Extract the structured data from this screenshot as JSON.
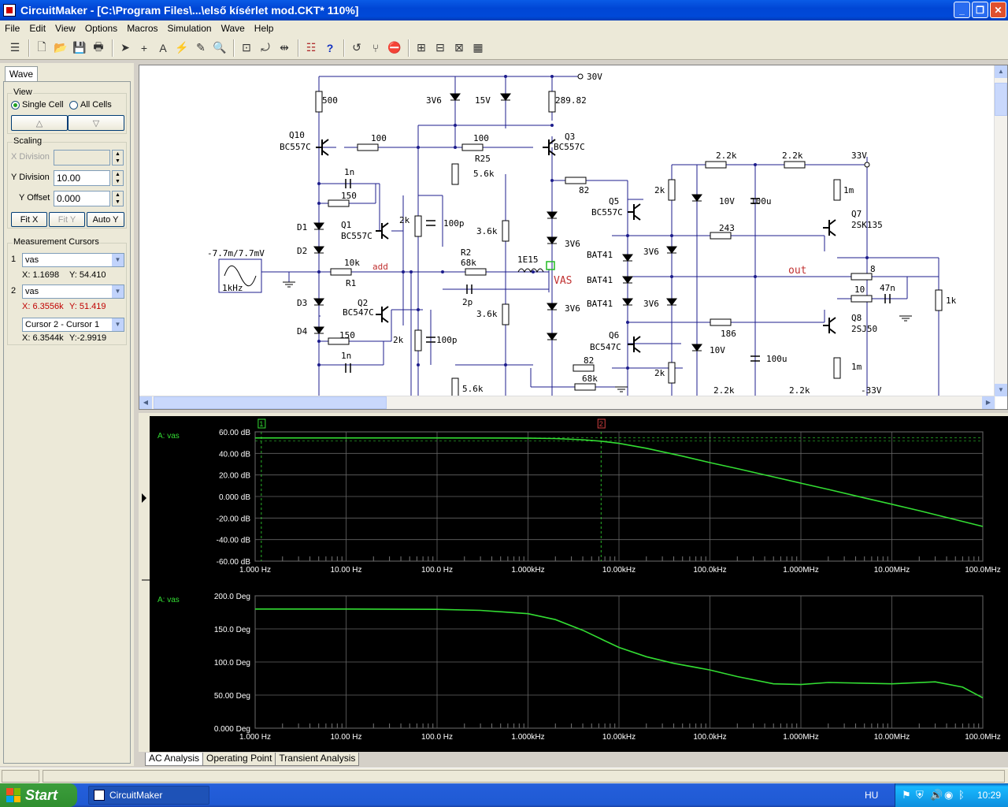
{
  "window": {
    "title": "CircuitMaker - [C:\\Program Files\\...\\első kísérlet mod.CKT* 110%]"
  },
  "menu": [
    "File",
    "Edit",
    "View",
    "Options",
    "Macros",
    "Simulation",
    "Wave",
    "Help"
  ],
  "panel": {
    "tab": "Wave",
    "view": {
      "label": "View",
      "single": "Single Cell",
      "all": "All Cells"
    },
    "scaling": {
      "label": "Scaling",
      "xdiv_label": "X Division",
      "xdiv_value": "",
      "ydiv_label": "Y Division",
      "ydiv_value": "10.00",
      "yoff_label": "Y Offset",
      "yoff_value": "0.000",
      "fitx": "Fit X",
      "fity": "Fit Y",
      "autoy": "Auto Y"
    },
    "cursors": {
      "label": "Measurement Cursors",
      "c1": {
        "num": "1",
        "signal": "vas",
        "x": "X: 1.1698",
        "y": "Y: 54.410"
      },
      "c2": {
        "num": "2",
        "signal": "vas",
        "x": "X: 6.3556k",
        "y": "Y: 51.419"
      },
      "diff": {
        "signal": "Cursor 2 - Cursor 1",
        "x": "X: 6.3544k",
        "y": "Y:-2.9919"
      }
    }
  },
  "schematic": {
    "labels": [
      "30V",
      "3V6",
      "15V",
      "500",
      "289.82",
      "Q10",
      "BC557C",
      "100",
      "100",
      "Q3",
      "BC557C",
      "R25",
      "5.6k",
      "2.2k",
      "2.2k",
      "33V",
      "82",
      "2k",
      "10V",
      "100u",
      "1m",
      "Q5",
      "BC557C",
      "1n",
      "3V6",
      "Q7",
      "2SK135",
      "150",
      "2k",
      "100p",
      "3.6k",
      "D1",
      "Q1",
      "BC557C",
      "243",
      "D2",
      "-7.7m/7.7mV",
      "10k",
      "add",
      "R2",
      "68k",
      "1E15",
      "BAT41",
      "3V6",
      "VAS",
      "out",
      "8",
      "R1",
      "BAT41",
      "10",
      "47n",
      "1k",
      "1kHz",
      "2p",
      "BAT41",
      "3V6",
      "D3",
      "Q2",
      "BC547C",
      "3V6",
      "3.6k",
      "Q8",
      "2SJ50",
      "186",
      "D4",
      "150",
      "2k",
      "100p",
      "Q6",
      "BC547C",
      "1n",
      "82",
      "10V",
      "100u",
      "1m",
      "68k",
      "2k",
      "5.6k",
      "2.2k",
      "2.2k",
      "-33V"
    ]
  },
  "chart_data": [
    {
      "type": "line",
      "title": "A: vas",
      "xlabel": "",
      "ylabel": "",
      "xscale": "log",
      "xlim": [
        1,
        100000000
      ],
      "ylim": [
        -60,
        60
      ],
      "xticks": [
        "1.000 Hz",
        "10.00 Hz",
        "100.0 Hz",
        "1.000kHz",
        "10.00kHz",
        "100.0kHz",
        "1.000MHz",
        "10.00MHz",
        "100.0MHz"
      ],
      "yticks": [
        "60.00 dB",
        "40.00 dB",
        "20.00 dB",
        "0.000 dB",
        "-20.00 dB",
        "-40.00 dB",
        "-60.00 dB"
      ],
      "series": [
        {
          "name": "vas",
          "color": "#33dd33",
          "x": [
            1,
            10,
            100,
            1000,
            2000,
            4000,
            6356,
            10000,
            20000,
            50000,
            100000,
            200000,
            500000,
            1000000,
            2000000,
            5000000,
            10000000,
            20000000,
            50000000,
            100000000
          ],
          "y": [
            54.4,
            54.4,
            54.4,
            54.2,
            53.8,
            52.7,
            51.4,
            49.3,
            44.8,
            37.5,
            31.5,
            25.9,
            18.2,
            12.4,
            6.6,
            -1.3,
            -7.2,
            -13.2,
            -21.5,
            -27.8
          ]
        }
      ],
      "cursors": [
        {
          "label": "1",
          "x": 1.1698
        },
        {
          "label": "2",
          "x": 6355.6
        }
      ],
      "grid": true
    },
    {
      "type": "line",
      "title": "A: vas",
      "xlabel": "",
      "ylabel": "",
      "xscale": "log",
      "xlim": [
        1,
        100000000
      ],
      "ylim": [
        0,
        200
      ],
      "xticks": [
        "1.000 Hz",
        "10.00 Hz",
        "100.0 Hz",
        "1.000kHz",
        "10.00kHz",
        "100.0kHz",
        "1.000MHz",
        "10.00MHz",
        "100.0MHz"
      ],
      "yticks": [
        "200.0 Deg",
        "150.0 Deg",
        "100.0 Deg",
        "50.00 Deg",
        "0.000 Deg"
      ],
      "series": [
        {
          "name": "vas",
          "color": "#33dd33",
          "x": [
            1,
            10,
            100,
            300,
            1000,
            2000,
            4000,
            7000,
            10000,
            20000,
            40000,
            100000,
            200000,
            500000,
            1000000,
            2000000,
            5000000,
            10000000,
            30000000,
            60000000,
            100000000
          ],
          "y": [
            180,
            180,
            179.5,
            178,
            173,
            164,
            148,
            132,
            122,
            108,
            98,
            88,
            78,
            67,
            66,
            69,
            68,
            67,
            70,
            62,
            46
          ]
        }
      ],
      "grid": true
    }
  ],
  "bottom_tabs": [
    "AC Analysis",
    "Operating Point",
    "Transient Analysis"
  ],
  "taskbar": {
    "start": "Start",
    "item": "CircuitMaker",
    "lang": "HU",
    "clock": "10:29"
  }
}
